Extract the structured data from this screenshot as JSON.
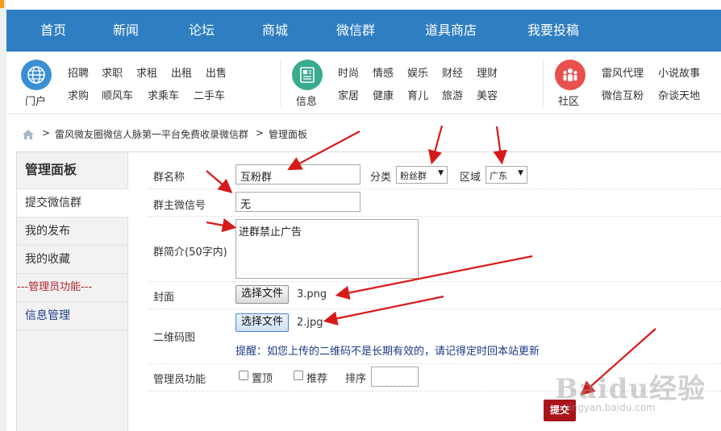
{
  "nav": {
    "items": [
      "首页",
      "新闻",
      "论坛",
      "商城",
      "微信群",
      "道具商店",
      "我要投稿"
    ]
  },
  "categories": {
    "portal": {
      "label": "门户",
      "links": [
        "招聘",
        "求职",
        "求租",
        "出租",
        "出售",
        "求购",
        "顺风车",
        "求乘车",
        "二手车"
      ]
    },
    "info": {
      "label": "信息",
      "links": [
        "时尚",
        "情感",
        "娱乐",
        "财经",
        "理财",
        "家居",
        "健康",
        "育儿",
        "旅游",
        "美容"
      ]
    },
    "community": {
      "label": "社区",
      "links": [
        "雷风代理",
        "小说故事",
        "微信互粉",
        "杂谈天地"
      ]
    },
    "colors": {
      "portal": "#3a8fd3",
      "info": "#3aaa8e",
      "community": "#e8504d"
    }
  },
  "breadcrumb": {
    "site": "雷风微友圈微信人脉第一平台免费收录微信群",
    "separator": ">",
    "current": "管理面板"
  },
  "sidebar": {
    "title": "管理面板",
    "items": [
      "提交微信群",
      "我的发布",
      "我的收藏",
      "---管理员功能---",
      "信息管理"
    ]
  },
  "form": {
    "group_name_label": "群名称",
    "group_name_value": "互粉群",
    "category_label": "分类",
    "category_value": "粉丝群",
    "region_label": "区域",
    "region_value": "广东",
    "owner_wechat_label": "群主微信号",
    "owner_wechat_value": "无",
    "intro_label": "群简介(50字内)",
    "intro_value": "进群禁止广告",
    "cover_label": "封面",
    "choose_file_label": "选择文件",
    "cover_file": "3.png",
    "qrcode_label": "二维码图",
    "qrcode_file": "2.jpg",
    "qrcode_tip": "提醒：如您上传的二维码不是长期有效的，请记得定时回本站更新",
    "admin_label": "管理员功能",
    "pin_label": "置顶",
    "recommend_label": "推荐",
    "sort_label": "排序",
    "sort_value": "",
    "submit_label": "提交"
  },
  "watermark": {
    "brand": "Baidu经验",
    "url": "jingyan.baidu.com"
  },
  "annotation_color": "#d61a1a"
}
